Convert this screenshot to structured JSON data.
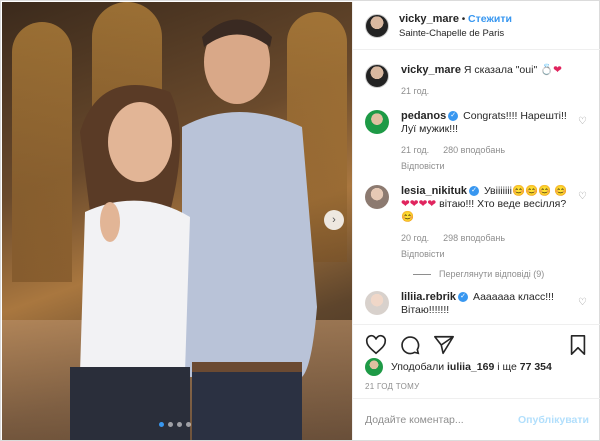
{
  "header": {
    "username": "vicky_mare",
    "separator": "•",
    "follow": "Стежити",
    "location": "Sainte-Chapelle de Paris"
  },
  "caption": {
    "username": "vicky_mare",
    "text": "Я сказала \"oui\"",
    "emoji": "💍❤",
    "time": "21 год."
  },
  "comments": [
    {
      "username": "pedanos",
      "verified": true,
      "text": "Congrats!!!! Нарешті!! Луї мужик!!!",
      "time": "21 год.",
      "likes": "280 вподобань",
      "reply": "Відповісти"
    },
    {
      "username": "lesia_nikituk",
      "verified": true,
      "text": "Увііііііі",
      "emoji1": "😊😊😊",
      "emoji2": "😊❤❤❤❤",
      "text2": "вітаю!!! Хто веде весілля?",
      "emoji3": "😊",
      "time": "20 год.",
      "likes": "298 вподобань",
      "reply": "Відповісти",
      "view_replies": "Переглянути відповіді (9)"
    },
    {
      "username": "liliia.rebrik",
      "verified": true,
      "text": "Ааааааа класс!!! Вітаю!!!!!!!"
    }
  ],
  "likes": {
    "prefix": "Уподобали",
    "user": "iuliia_169",
    "middle": "і ще",
    "count": "77 354"
  },
  "time_ago": "21 ГОД ТОМУ",
  "comment_box": {
    "placeholder": "Додайте коментар...",
    "publish": "Опублікувати"
  },
  "carousel": {
    "slides": 4,
    "active": 1
  },
  "colors": {
    "accent": "#3897f0",
    "muted": "#8e8e8e",
    "publish_disabled": "#b2dffc"
  }
}
